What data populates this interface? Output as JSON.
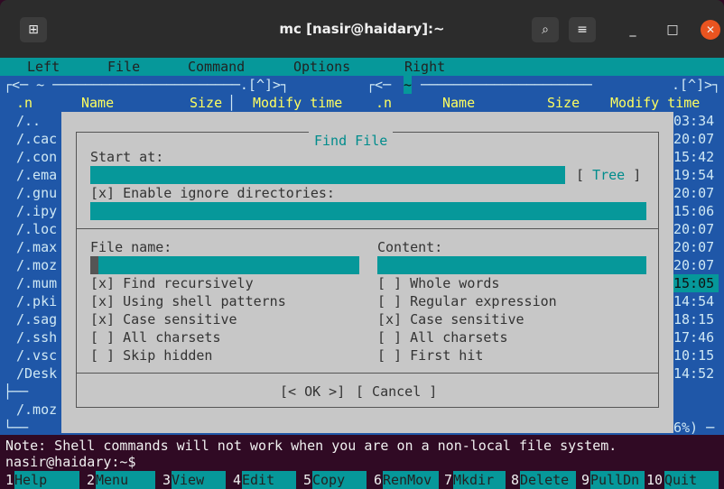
{
  "window": {
    "title": "mc [nasir@haidary]:~"
  },
  "menu": [
    "Left",
    "File",
    "Command",
    "Options",
    "Right"
  ],
  "left_panel": {
    "header": "┌<─ ~ ──────────────────────.[^]>┐",
    "cols": {
      "n": ".n",
      "name": "Name",
      "size": "Size",
      "mtime": "Modify time"
    },
    "files": [
      "/..",
      "/.cac",
      "/.con",
      "/.ema",
      "/.gnu",
      "/.ipy",
      "/.loc",
      "/.max",
      "/.moz",
      "/.mum",
      "/.pki",
      "/.sag",
      "/.ssh",
      "/.vsc",
      "/Desk"
    ],
    "status": "/.moz"
  },
  "right_panel": {
    "header_dir": "~",
    "header_tail": ".[^]>┐",
    "cols": {
      "n": ".n",
      "name": "Name",
      "size": "Size",
      "mtime": "Modify time"
    },
    "times": [
      "03:34",
      "20:07",
      "15:42",
      "19:54",
      "20:07",
      "15:06",
      "20:07",
      "20:07",
      "20:07",
      "15:05",
      "14:54",
      "18:15",
      "17:46",
      "10:15",
      "14:52"
    ],
    "selected_index": 9,
    "footer": "6%) ─"
  },
  "dialog": {
    "title": "Find File",
    "start_at_label": "Start at:",
    "tree_button": "[ Tree ]",
    "enable_ignore": "[x] Enable ignore directories:",
    "file_name_label": "File name:",
    "content_label": "Content:",
    "left_options": [
      "[x] Find recursively",
      "[x] Using shell patterns",
      "[x] Case sensitive",
      "[ ] All charsets",
      "[ ] Skip hidden"
    ],
    "right_options": [
      "[ ] Whole words",
      "[ ] Regular expression",
      "[x] Case sensitive",
      "[ ] All charsets",
      "[ ] First hit"
    ],
    "ok_button": "[< OK >]",
    "cancel_button": "[ Cancel ]"
  },
  "note": "Note: Shell commands will not work when you are on a non-local file system.",
  "prompt": "nasir@haidary:~$",
  "fkeys": [
    {
      "num": "1",
      "label": "Help"
    },
    {
      "num": "2",
      "label": "Menu"
    },
    {
      "num": "3",
      "label": "View"
    },
    {
      "num": "4",
      "label": "Edit"
    },
    {
      "num": "5",
      "label": "Copy"
    },
    {
      "num": "6",
      "label": "RenMov"
    },
    {
      "num": "7",
      "label": "Mkdir"
    },
    {
      "num": "8",
      "label": "Delete"
    },
    {
      "num": "9",
      "label": "PullDn"
    },
    {
      "num": "10",
      "label": "Quit"
    }
  ],
  "colors": {
    "panel": "#1f57a8",
    "accent": "#06989a",
    "dialog": "#c7c7c7",
    "terminal_bg": "#300a24"
  }
}
